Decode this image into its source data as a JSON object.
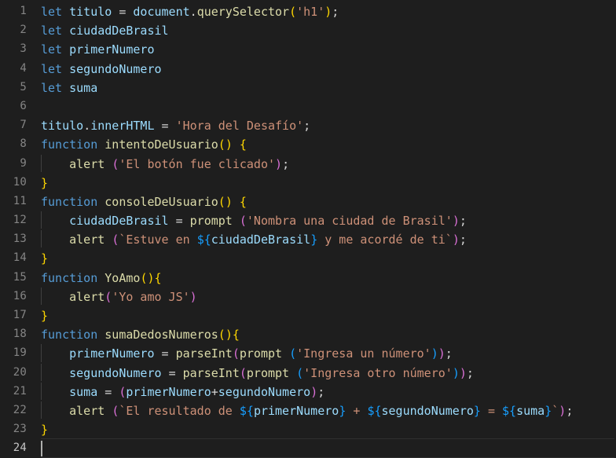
{
  "editor": {
    "name": "code-editor",
    "language": "javascript",
    "theme": "dark-plus",
    "total_lines": 24,
    "active_line": 24,
    "cursor": {
      "line": 24,
      "column": 1
    },
    "colors": {
      "background": "#1e1e1e",
      "gutter_text": "#858585",
      "gutter_active_text": "#c6c6c6",
      "keyword": "#569cd6",
      "variable": "#9cdcfe",
      "function": "#dcdcaa",
      "string": "#ce9178",
      "operator": "#d4d4d4",
      "bracket_level_1": "#ffd700",
      "bracket_level_2": "#da70d6",
      "bracket_level_3": "#179fff",
      "caret": "#aeafad",
      "indent_guide": "#404040",
      "active_line_border": "#303030"
    }
  },
  "lines": [
    {
      "num": "1",
      "indent": 0,
      "active": false,
      "text": "let titulo = document.querySelector('h1');",
      "tokens": [
        {
          "t": "let",
          "c": "kw"
        },
        {
          "t": " ",
          "c": "op"
        },
        {
          "t": "titulo",
          "c": "var"
        },
        {
          "t": " ",
          "c": "op"
        },
        {
          "t": "=",
          "c": "op"
        },
        {
          "t": " ",
          "c": "op"
        },
        {
          "t": "document",
          "c": "var"
        },
        {
          "t": ".",
          "c": "op"
        },
        {
          "t": "querySelector",
          "c": "fn"
        },
        {
          "t": "(",
          "c": "b1"
        },
        {
          "t": "'h1'",
          "c": "str"
        },
        {
          "t": ")",
          "c": "b1"
        },
        {
          "t": ";",
          "c": "op"
        }
      ]
    },
    {
      "num": "2",
      "indent": 0,
      "active": false,
      "text": "let ciudadDeBrasil",
      "tokens": [
        {
          "t": "let",
          "c": "kw"
        },
        {
          "t": " ",
          "c": "op"
        },
        {
          "t": "ciudadDeBrasil",
          "c": "var"
        }
      ]
    },
    {
      "num": "3",
      "indent": 0,
      "active": false,
      "text": "let primerNumero",
      "tokens": [
        {
          "t": "let",
          "c": "kw"
        },
        {
          "t": " ",
          "c": "op"
        },
        {
          "t": "primerNumero",
          "c": "var"
        }
      ]
    },
    {
      "num": "4",
      "indent": 0,
      "active": false,
      "text": "let segundoNumero",
      "tokens": [
        {
          "t": "let",
          "c": "kw"
        },
        {
          "t": " ",
          "c": "op"
        },
        {
          "t": "segundoNumero",
          "c": "var"
        }
      ]
    },
    {
      "num": "5",
      "indent": 0,
      "active": false,
      "text": "let suma",
      "tokens": [
        {
          "t": "let",
          "c": "kw"
        },
        {
          "t": " ",
          "c": "op"
        },
        {
          "t": "suma",
          "c": "var"
        }
      ]
    },
    {
      "num": "6",
      "indent": 0,
      "active": false,
      "text": "",
      "tokens": []
    },
    {
      "num": "7",
      "indent": 0,
      "active": false,
      "text": "titulo.innerHTML = 'Hora del Desafío';",
      "tokens": [
        {
          "t": "titulo",
          "c": "var"
        },
        {
          "t": ".",
          "c": "op"
        },
        {
          "t": "innerHTML",
          "c": "var"
        },
        {
          "t": " ",
          "c": "op"
        },
        {
          "t": "=",
          "c": "op"
        },
        {
          "t": " ",
          "c": "op"
        },
        {
          "t": "'Hora del Desafío'",
          "c": "str"
        },
        {
          "t": ";",
          "c": "op"
        }
      ]
    },
    {
      "num": "8",
      "indent": 0,
      "active": false,
      "text": "function intentoDeUsuario() {",
      "tokens": [
        {
          "t": "function",
          "c": "kw"
        },
        {
          "t": " ",
          "c": "op"
        },
        {
          "t": "intentoDeUsuario",
          "c": "fn"
        },
        {
          "t": "(",
          "c": "b1"
        },
        {
          "t": ")",
          "c": "b1"
        },
        {
          "t": " ",
          "c": "op"
        },
        {
          "t": "{",
          "c": "b1"
        }
      ]
    },
    {
      "num": "9",
      "indent": 1,
      "active": false,
      "text": "    alert ('El botón fue clicado');",
      "tokens": [
        {
          "t": "    ",
          "c": "op"
        },
        {
          "t": "alert",
          "c": "fn"
        },
        {
          "t": " ",
          "c": "op"
        },
        {
          "t": "(",
          "c": "b2"
        },
        {
          "t": "'El botón fue clicado'",
          "c": "str"
        },
        {
          "t": ")",
          "c": "b2"
        },
        {
          "t": ";",
          "c": "op"
        }
      ]
    },
    {
      "num": "10",
      "indent": 0,
      "active": false,
      "text": "}",
      "tokens": [
        {
          "t": "}",
          "c": "b1"
        }
      ]
    },
    {
      "num": "11",
      "indent": 0,
      "active": false,
      "text": "function consoleDeUsuario() {",
      "tokens": [
        {
          "t": "function",
          "c": "kw"
        },
        {
          "t": " ",
          "c": "op"
        },
        {
          "t": "consoleDeUsuario",
          "c": "fn"
        },
        {
          "t": "(",
          "c": "b1"
        },
        {
          "t": ")",
          "c": "b1"
        },
        {
          "t": " ",
          "c": "op"
        },
        {
          "t": "{",
          "c": "b1"
        }
      ]
    },
    {
      "num": "12",
      "indent": 1,
      "active": false,
      "text": "    ciudadDeBrasil = prompt ('Nombra una ciudad de Brasil');",
      "tokens": [
        {
          "t": "    ",
          "c": "op"
        },
        {
          "t": "ciudadDeBrasil",
          "c": "var"
        },
        {
          "t": " ",
          "c": "op"
        },
        {
          "t": "=",
          "c": "op"
        },
        {
          "t": " ",
          "c": "op"
        },
        {
          "t": "prompt",
          "c": "fn"
        },
        {
          "t": " ",
          "c": "op"
        },
        {
          "t": "(",
          "c": "b2"
        },
        {
          "t": "'Nombra una ciudad de Brasil'",
          "c": "str"
        },
        {
          "t": ")",
          "c": "b2"
        },
        {
          "t": ";",
          "c": "op"
        }
      ]
    },
    {
      "num": "13",
      "indent": 1,
      "active": false,
      "text": "    alert (`Estuve en ${ciudadDeBrasil} y me acordé de ti`);",
      "tokens": [
        {
          "t": "    ",
          "c": "op"
        },
        {
          "t": "alert",
          "c": "fn"
        },
        {
          "t": " ",
          "c": "op"
        },
        {
          "t": "(",
          "c": "b2"
        },
        {
          "t": "`Estuve en ",
          "c": "str"
        },
        {
          "t": "${",
          "c": "b3"
        },
        {
          "t": "ciudadDeBrasil",
          "c": "var"
        },
        {
          "t": "}",
          "c": "b3"
        },
        {
          "t": " y me acordé de ti`",
          "c": "str"
        },
        {
          "t": ")",
          "c": "b2"
        },
        {
          "t": ";",
          "c": "op"
        }
      ]
    },
    {
      "num": "14",
      "indent": 0,
      "active": false,
      "text": "}",
      "tokens": [
        {
          "t": "}",
          "c": "b1"
        }
      ]
    },
    {
      "num": "15",
      "indent": 0,
      "active": false,
      "text": "function YoAmo(){",
      "tokens": [
        {
          "t": "function",
          "c": "kw"
        },
        {
          "t": " ",
          "c": "op"
        },
        {
          "t": "YoAmo",
          "c": "fn"
        },
        {
          "t": "(",
          "c": "b1"
        },
        {
          "t": ")",
          "c": "b1"
        },
        {
          "t": "{",
          "c": "b1"
        }
      ]
    },
    {
      "num": "16",
      "indent": 1,
      "active": false,
      "text": "    alert('Yo amo JS')",
      "tokens": [
        {
          "t": "    ",
          "c": "op"
        },
        {
          "t": "alert",
          "c": "fn"
        },
        {
          "t": "(",
          "c": "b2"
        },
        {
          "t": "'Yo amo JS'",
          "c": "str"
        },
        {
          "t": ")",
          "c": "b2"
        }
      ]
    },
    {
      "num": "17",
      "indent": 0,
      "active": false,
      "text": "}",
      "tokens": [
        {
          "t": "}",
          "c": "b1"
        }
      ]
    },
    {
      "num": "18",
      "indent": 0,
      "active": false,
      "text": "function sumaDedosNumeros(){",
      "tokens": [
        {
          "t": "function",
          "c": "kw"
        },
        {
          "t": " ",
          "c": "op"
        },
        {
          "t": "sumaDedosNumeros",
          "c": "fn"
        },
        {
          "t": "(",
          "c": "b1"
        },
        {
          "t": ")",
          "c": "b1"
        },
        {
          "t": "{",
          "c": "b1"
        }
      ]
    },
    {
      "num": "19",
      "indent": 1,
      "active": false,
      "text": "    primerNumero = parseInt(prompt ('Ingresa un número'));",
      "tokens": [
        {
          "t": "    ",
          "c": "op"
        },
        {
          "t": "primerNumero",
          "c": "var"
        },
        {
          "t": " ",
          "c": "op"
        },
        {
          "t": "=",
          "c": "op"
        },
        {
          "t": " ",
          "c": "op"
        },
        {
          "t": "parseInt",
          "c": "fn"
        },
        {
          "t": "(",
          "c": "b2"
        },
        {
          "t": "prompt",
          "c": "fn"
        },
        {
          "t": " ",
          "c": "op"
        },
        {
          "t": "(",
          "c": "b3"
        },
        {
          "t": "'Ingresa un número'",
          "c": "str"
        },
        {
          "t": ")",
          "c": "b3"
        },
        {
          "t": ")",
          "c": "b2"
        },
        {
          "t": ";",
          "c": "op"
        }
      ]
    },
    {
      "num": "20",
      "indent": 1,
      "active": false,
      "text": "    segundoNumero = parseInt(prompt ('Ingresa otro número'));",
      "tokens": [
        {
          "t": "    ",
          "c": "op"
        },
        {
          "t": "segundoNumero",
          "c": "var"
        },
        {
          "t": " ",
          "c": "op"
        },
        {
          "t": "=",
          "c": "op"
        },
        {
          "t": " ",
          "c": "op"
        },
        {
          "t": "parseInt",
          "c": "fn"
        },
        {
          "t": "(",
          "c": "b2"
        },
        {
          "t": "prompt",
          "c": "fn"
        },
        {
          "t": " ",
          "c": "op"
        },
        {
          "t": "(",
          "c": "b3"
        },
        {
          "t": "'Ingresa otro número'",
          "c": "str"
        },
        {
          "t": ")",
          "c": "b3"
        },
        {
          "t": ")",
          "c": "b2"
        },
        {
          "t": ";",
          "c": "op"
        }
      ]
    },
    {
      "num": "21",
      "indent": 1,
      "active": false,
      "text": "    suma = (primerNumero+segundoNumero);",
      "tokens": [
        {
          "t": "    ",
          "c": "op"
        },
        {
          "t": "suma",
          "c": "var"
        },
        {
          "t": " ",
          "c": "op"
        },
        {
          "t": "=",
          "c": "op"
        },
        {
          "t": " ",
          "c": "op"
        },
        {
          "t": "(",
          "c": "b2"
        },
        {
          "t": "primerNumero",
          "c": "var"
        },
        {
          "t": "+",
          "c": "op"
        },
        {
          "t": "segundoNumero",
          "c": "var"
        },
        {
          "t": ")",
          "c": "b2"
        },
        {
          "t": ";",
          "c": "op"
        }
      ]
    },
    {
      "num": "22",
      "indent": 1,
      "active": false,
      "text": "    alert (`El resultado de ${primerNumero} + ${segundoNumero} = ${suma}`);",
      "tokens": [
        {
          "t": "    ",
          "c": "op"
        },
        {
          "t": "alert",
          "c": "fn"
        },
        {
          "t": " ",
          "c": "op"
        },
        {
          "t": "(",
          "c": "b2"
        },
        {
          "t": "`El resultado de ",
          "c": "str"
        },
        {
          "t": "${",
          "c": "b3"
        },
        {
          "t": "primerNumero",
          "c": "var"
        },
        {
          "t": "}",
          "c": "b3"
        },
        {
          "t": " + ",
          "c": "str"
        },
        {
          "t": "${",
          "c": "b3"
        },
        {
          "t": "segundoNumero",
          "c": "var"
        },
        {
          "t": "}",
          "c": "b3"
        },
        {
          "t": " = ",
          "c": "str"
        },
        {
          "t": "${",
          "c": "b3"
        },
        {
          "t": "suma",
          "c": "var"
        },
        {
          "t": "}",
          "c": "b3"
        },
        {
          "t": "`",
          "c": "str"
        },
        {
          "t": ")",
          "c": "b2"
        },
        {
          "t": ";",
          "c": "op"
        }
      ]
    },
    {
      "num": "23",
      "indent": 0,
      "active": false,
      "text": "}",
      "tokens": [
        {
          "t": "}",
          "c": "b1"
        }
      ]
    },
    {
      "num": "24",
      "indent": 0,
      "active": true,
      "text": "",
      "tokens": []
    }
  ]
}
